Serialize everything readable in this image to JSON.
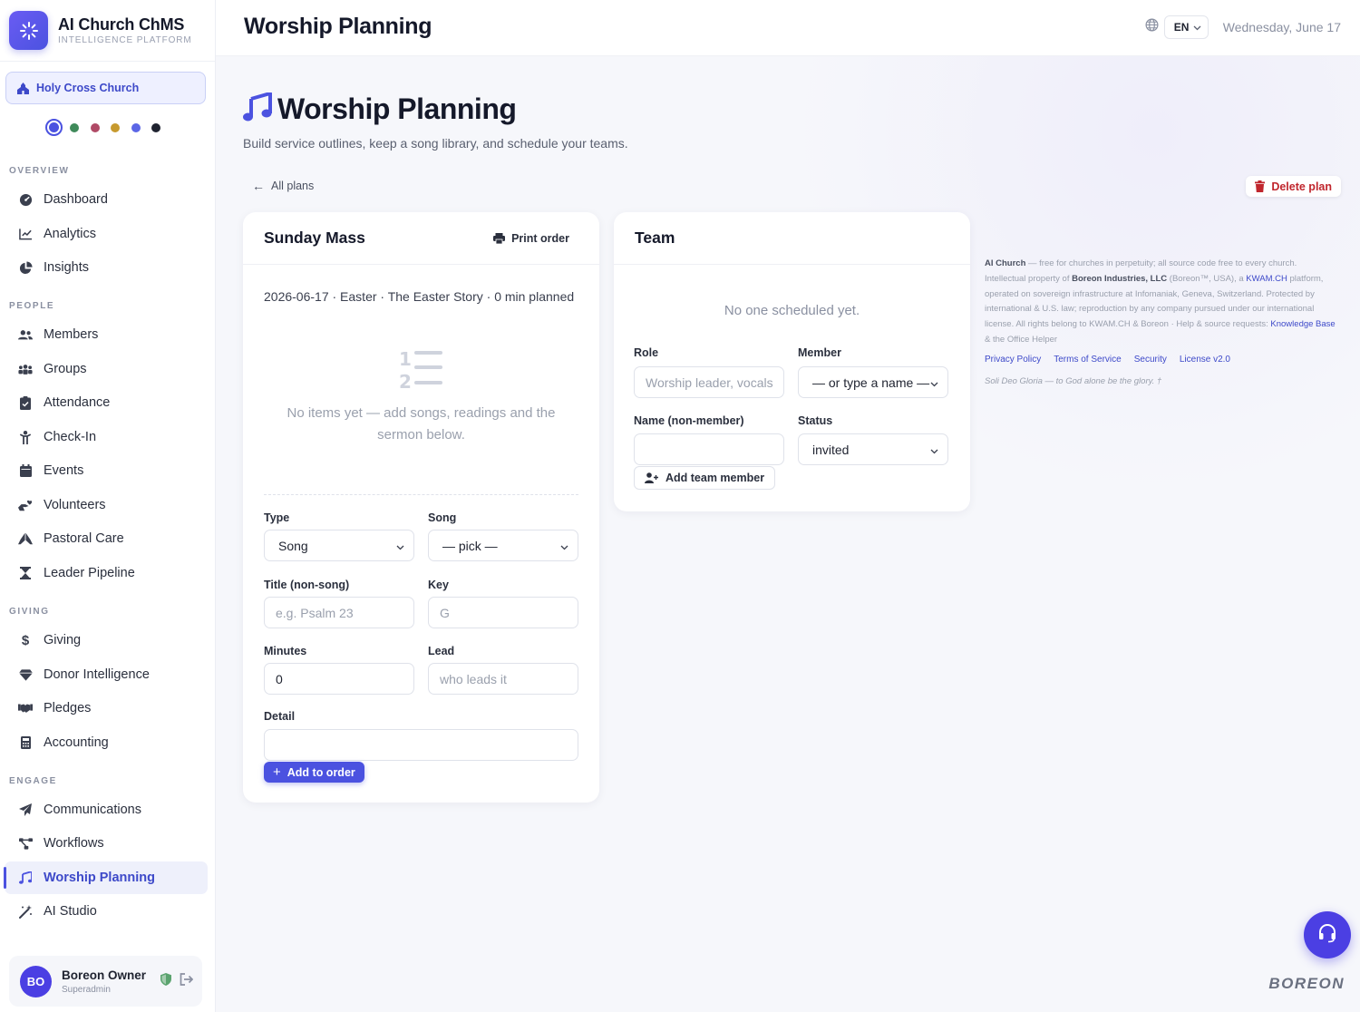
{
  "brand": {
    "name": "AI Church ChMS",
    "subtitle": "INTELLIGENCE PLATFORM"
  },
  "church": {
    "name": "Holy Cross Church"
  },
  "theme_colors": [
    "#4b52e0",
    "#3f8a5a",
    "#b04a66",
    "#c79a2e",
    "#5b66e6",
    "#1f2330"
  ],
  "nav": {
    "overview_label": "OVERVIEW",
    "people_label": "PEOPLE",
    "giving_label": "GIVING",
    "engage_label": "ENGAGE",
    "items": [
      {
        "label": "Dashboard",
        "icon": "dashboard-icon"
      },
      {
        "label": "Analytics",
        "icon": "chart-line-icon"
      },
      {
        "label": "Insights",
        "icon": "pie-chart-icon"
      },
      {
        "label": "Members",
        "icon": "users-icon"
      },
      {
        "label": "Groups",
        "icon": "group-icon"
      },
      {
        "label": "Attendance",
        "icon": "clipboard-check-icon"
      },
      {
        "label": "Check-In",
        "icon": "child-icon"
      },
      {
        "label": "Events",
        "icon": "calendar-icon"
      },
      {
        "label": "Volunteers",
        "icon": "hands-heart-icon"
      },
      {
        "label": "Pastoral Care",
        "icon": "praying-hands-icon"
      },
      {
        "label": "Leader Pipeline",
        "icon": "hourglass-icon"
      },
      {
        "label": "Giving",
        "icon": "dollar-icon"
      },
      {
        "label": "Donor Intelligence",
        "icon": "gem-icon"
      },
      {
        "label": "Pledges",
        "icon": "handshake-icon"
      },
      {
        "label": "Accounting",
        "icon": "calculator-icon"
      },
      {
        "label": "Communications",
        "icon": "paper-plane-icon"
      },
      {
        "label": "Workflows",
        "icon": "workflow-icon"
      },
      {
        "label": "Worship Planning",
        "icon": "music-icon"
      },
      {
        "label": "AI Studio",
        "icon": "magic-wand-icon"
      }
    ]
  },
  "user": {
    "initials": "BO",
    "name": "Boreon Owner",
    "role": "Superadmin"
  },
  "topbar": {
    "title": "Worship Planning",
    "lang": "EN",
    "date": "Wednesday, June 17"
  },
  "page": {
    "title": "Worship Planning",
    "subtitle": "Build service outlines, keep a song library, and schedule your teams.",
    "back_label": "All plans",
    "delete_label": "Delete plan"
  },
  "plan": {
    "title": "Sunday Mass",
    "print_label": "Print order",
    "meta": "2026-06-17 · Easter · The Easter Story · 0 min planned",
    "empty_text": "No items yet — add songs, readings and the sermon below.",
    "form": {
      "type_label": "Type",
      "type_value": "Song",
      "song_label": "Song",
      "song_value": "— pick —",
      "title_label": "Title (non-song)",
      "title_placeholder": "e.g. Psalm 23",
      "key_label": "Key",
      "key_placeholder": "G",
      "minutes_label": "Minutes",
      "minutes_value": "0",
      "lead_label": "Lead",
      "lead_placeholder": "who leads it",
      "detail_label": "Detail",
      "detail_value": "",
      "add_label": "Add to order"
    }
  },
  "team": {
    "title": "Team",
    "empty_text": "No one scheduled yet.",
    "role_label": "Role",
    "role_placeholder": "Worship leader, vocals",
    "member_label": "Member",
    "member_value": "— or type a name —",
    "name_label": "Name (non-member)",
    "name_value": "",
    "status_label": "Status",
    "status_value": "invited",
    "add_label": "Add team member"
  },
  "legal": {
    "p1": "AI Church",
    "p2": " — free for churches in perpetuity; all source code free to every church. Intellectual property of ",
    "p3": "Boreon Industries, LLC",
    "p4": " (Boreon™, USA), a ",
    "p5": "KWAM.CH",
    "p6": " platform, operated on sovereign infrastructure at Infomaniak, Geneva, Switzerland. Protected by international & U.S. law; reproduction by any company pursued under our international license. All rights belong to KWAM.CH & Boreon · Help & source requests: ",
    "p7": "Knowledge Base",
    "p8": " & the Office Helper",
    "links": [
      "Privacy Policy",
      "Terms of Service",
      "Security",
      "License v2.0"
    ],
    "motto": "Soli Deo Gloria — to God alone be the glory. †"
  },
  "footer_brand": "BOREON"
}
